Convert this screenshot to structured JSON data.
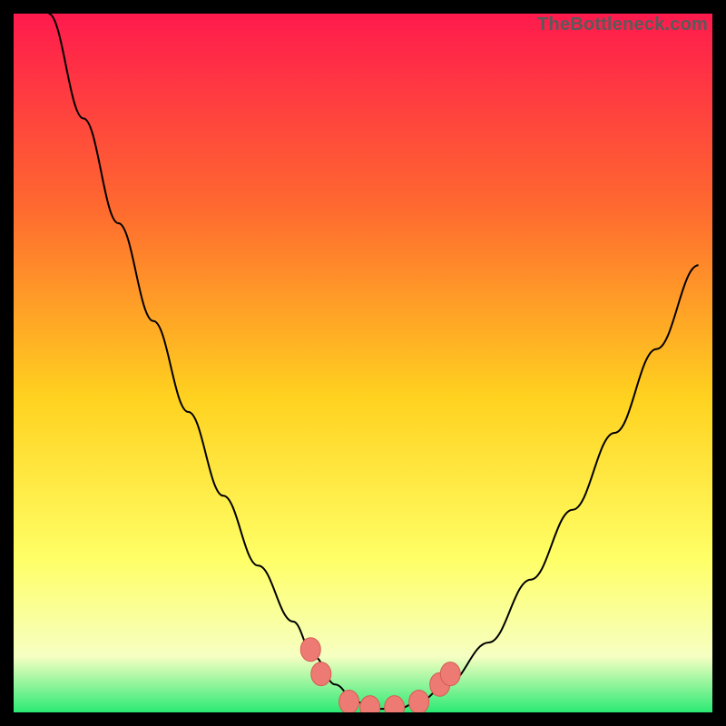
{
  "watermark": "TheBottleneck.com",
  "colors": {
    "frame": "#000000",
    "gradient_top": "#ff1a4d",
    "gradient_mid_upper": "#ff6a2f",
    "gradient_mid": "#ffd21f",
    "gradient_mid_lower": "#ffff66",
    "gradient_lower": "#f6ffc2",
    "gradient_bottom": "#2bea74",
    "curve": "#000000",
    "marker_fill": "#ed7b73",
    "marker_stroke": "#d65b54"
  },
  "chart_data": {
    "type": "line",
    "title": "",
    "xlabel": "",
    "ylabel": "",
    "xlim": [
      0,
      100
    ],
    "ylim": [
      0,
      100
    ],
    "series": [
      {
        "name": "bottleneck-curve",
        "x": [
          5,
          10,
          15,
          20,
          25,
          30,
          35,
          40,
          43,
          46,
          49,
          52,
          55,
          58,
          62,
          68,
          74,
          80,
          86,
          92,
          98
        ],
        "values": [
          100,
          85,
          70,
          56,
          43,
          31,
          21,
          13,
          8,
          4,
          1.5,
          0.5,
          0.5,
          1.5,
          4,
          10,
          19,
          29,
          40,
          52,
          64
        ]
      }
    ],
    "markers": [
      {
        "name": "left-shoulder-top",
        "x": 42.5,
        "y": 9.0
      },
      {
        "name": "left-shoulder-mid",
        "x": 44.0,
        "y": 5.5
      },
      {
        "name": "valley-left",
        "x": 48.0,
        "y": 1.5
      },
      {
        "name": "valley-center-left",
        "x": 51.0,
        "y": 0.7
      },
      {
        "name": "valley-center-right",
        "x": 54.5,
        "y": 0.7
      },
      {
        "name": "valley-right",
        "x": 58.0,
        "y": 1.5
      },
      {
        "name": "right-shoulder-mid",
        "x": 61.0,
        "y": 4.0
      },
      {
        "name": "right-shoulder-top",
        "x": 62.5,
        "y": 5.5
      }
    ],
    "grid": false
  }
}
